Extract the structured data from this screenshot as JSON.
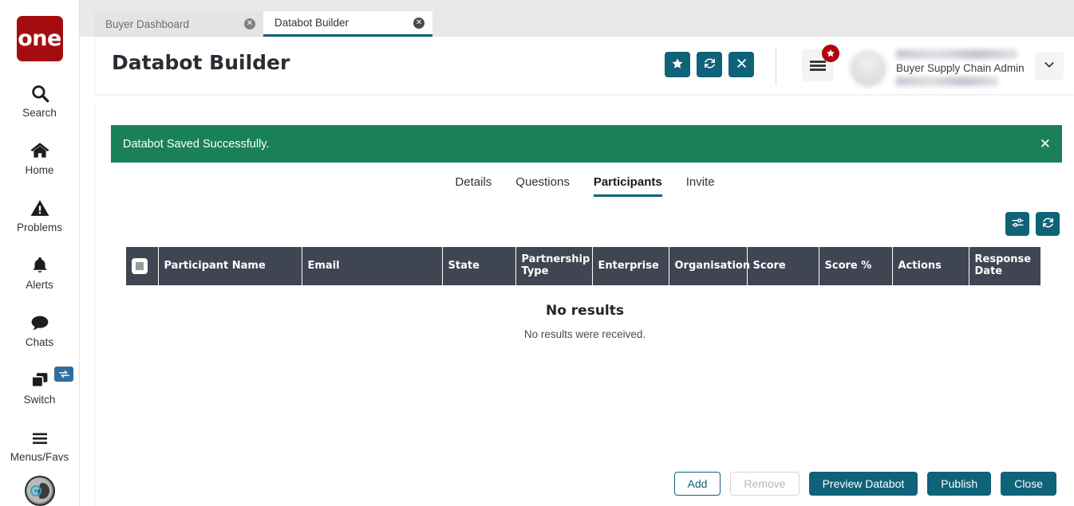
{
  "app": {
    "logo_text": "one"
  },
  "sidebar": {
    "items": [
      {
        "label": "Search",
        "icon": "search-icon"
      },
      {
        "label": "Home",
        "icon": "home-icon"
      },
      {
        "label": "Problems",
        "icon": "warning-triangle-icon"
      },
      {
        "label": "Alerts",
        "icon": "bell-icon"
      },
      {
        "label": "Chats",
        "icon": "chat-bubble-icon"
      },
      {
        "label": "Switch",
        "icon": "windows-stack-icon",
        "badge_icon": "swap-arrows-icon"
      },
      {
        "label": "Menus/Favs",
        "icon": "hamburger-icon"
      }
    ],
    "assistant_icon": "ai-assistant-avatar"
  },
  "browser_tabs": [
    {
      "label": "Buyer Dashboard",
      "active": false
    },
    {
      "label": "Databot Builder",
      "active": true
    }
  ],
  "header": {
    "title": "Databot Builder",
    "actions": [
      {
        "name": "favorite-button",
        "icon": "star-icon"
      },
      {
        "name": "refresh-button",
        "icon": "refresh-icon"
      },
      {
        "name": "close-button",
        "icon": "close-x-icon"
      }
    ],
    "menu_icon": "hamburger-menu-icon",
    "favorites_badge_icon": "star-badge-icon",
    "user": {
      "name_masked": "",
      "role": "Buyer Supply Chain Admin",
      "org_masked": ""
    },
    "caret_icon": "chevron-down-icon"
  },
  "alert": {
    "message": "Databot Saved Successfully.",
    "close_icon": "close-x-icon",
    "color": "#1a8059"
  },
  "subtabs": [
    {
      "label": "Details",
      "active": false
    },
    {
      "label": "Questions",
      "active": false
    },
    {
      "label": "Participants",
      "active": true
    },
    {
      "label": "Invite",
      "active": false
    }
  ],
  "table_toolbar": [
    {
      "name": "column-settings-button",
      "icon": "sliders-icon"
    },
    {
      "name": "refresh-table-button",
      "icon": "refresh-icon"
    }
  ],
  "table": {
    "select_all_state": "indeterminate",
    "columns": [
      "Participant Name",
      "Email",
      "State",
      "Partnership Type",
      "Enterprise",
      "Organisation",
      "Score",
      "Score %",
      "Actions",
      "Response Date"
    ],
    "rows": [],
    "empty_title": "No results",
    "empty_subtitle": "No results were received."
  },
  "footer_buttons": [
    {
      "label": "Add",
      "style": "outline",
      "enabled": true
    },
    {
      "label": "Remove",
      "style": "disabled",
      "enabled": false
    },
    {
      "label": "Preview Databot",
      "style": "primary",
      "enabled": true
    },
    {
      "label": "Publish",
      "style": "primary",
      "enabled": true
    },
    {
      "label": "Close",
      "style": "primary",
      "enabled": true
    }
  ],
  "theme": {
    "accent": "#0e6378",
    "brand_red": "#a50c10",
    "success_green": "#1a8059",
    "table_header": "#3f4552"
  }
}
